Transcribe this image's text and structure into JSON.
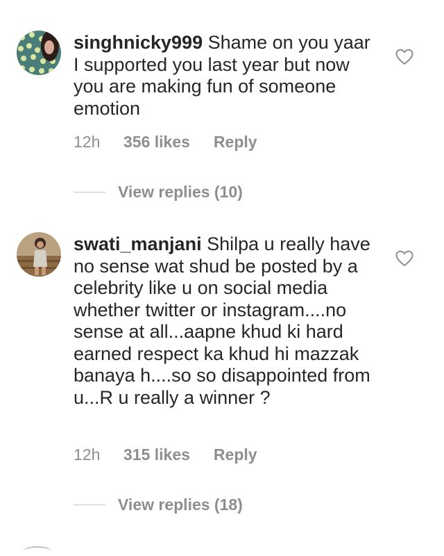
{
  "comments": [
    {
      "username": "singhnicky999",
      "text": "Shame on you yaar I supported you last year but now you are making fun of someone emotion",
      "time": "12h",
      "likes": "356 likes",
      "reply_label": "Reply",
      "view_replies": "View replies (10)",
      "avatar_icon": "polka-dot-avatar"
    },
    {
      "username": "swati_manjani",
      "text": "Shilpa u really have no sense wat shud be posted by a celebrity like u on social media whether twitter or instagram....no sense at all...aapne khud ki hard earned respect ka khud hi mazzak banaya h....so so disappointed from u...R u really a winner ?",
      "time": "12h",
      "likes": "315 likes",
      "reply_label": "Reply",
      "view_replies": "View replies (18)",
      "avatar_icon": "person-photo-avatar"
    }
  ],
  "colors": {
    "text": "#262626",
    "secondary": "#8e8e8e",
    "divider": "#c7c7c7"
  }
}
